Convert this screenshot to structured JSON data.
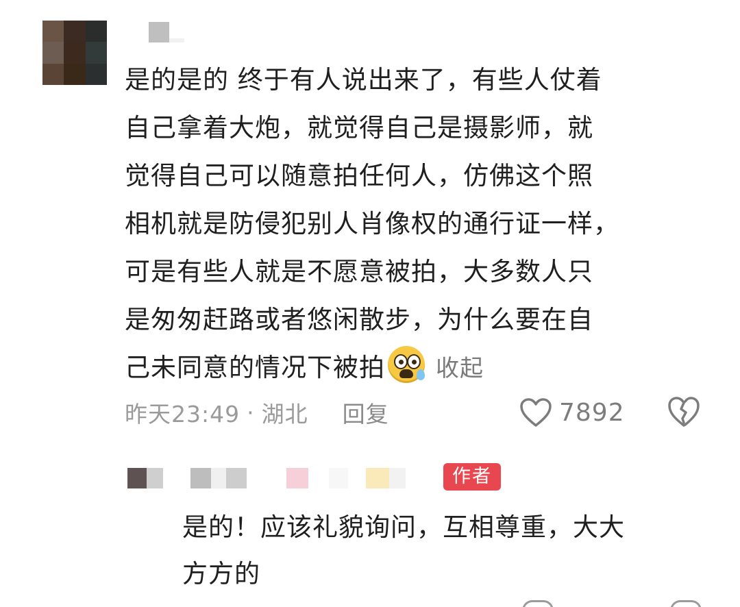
{
  "comment": {
    "avatar_pixels": [
      "#6a5446",
      "#3b2b22",
      "#2b2d2d",
      "#6d5c52",
      "#3d2a1f",
      "#323a3a",
      "#5a4436",
      "#3a2818",
      "#2b2f30"
    ],
    "username_pixels": [
      "#bfbfbf",
      "#f1f1f1"
    ],
    "text_lines": [
      "是的是的 终于有人说出来了，有些人仗着",
      "自己拿着大炮，就觉得自己是摄影师，就",
      "觉得自己可以随意拍任何人，仿佛这个照",
      "相机就是防侵犯别人肖像权的通行证一样，",
      "可是有些人就是不愿意被拍，大多数人只",
      "是匆匆赶路或者悠闲散步，为什么要在自",
      "己未同意的情况下被拍"
    ],
    "emoji_icon": "anxious-face-with-sweat-icon",
    "collapse_label": "收起",
    "time": "昨天23:49",
    "separator": "·",
    "location": "湖北",
    "reply_label": "回复",
    "like_count": "7892"
  },
  "reply": {
    "username_pixels": [
      "#5e5253",
      "#cfcfcf",
      "#ffffff",
      "#bdbdbd",
      "#f0f0f0",
      "#cdcdcd",
      "#ffffff",
      "#f6cfd9",
      "#ffffff",
      "#f7f7f7",
      "#ffffff",
      "#fbeab9",
      "#f2f2f2"
    ],
    "author_badge": "作者",
    "text_lines": [
      "是的！应该礼貌询问，互相尊重，大大",
      "方方的"
    ]
  },
  "colors": {
    "text": "#1f1f1f",
    "meta": "#9a9a9a",
    "badge_bg": "#e8474f"
  }
}
